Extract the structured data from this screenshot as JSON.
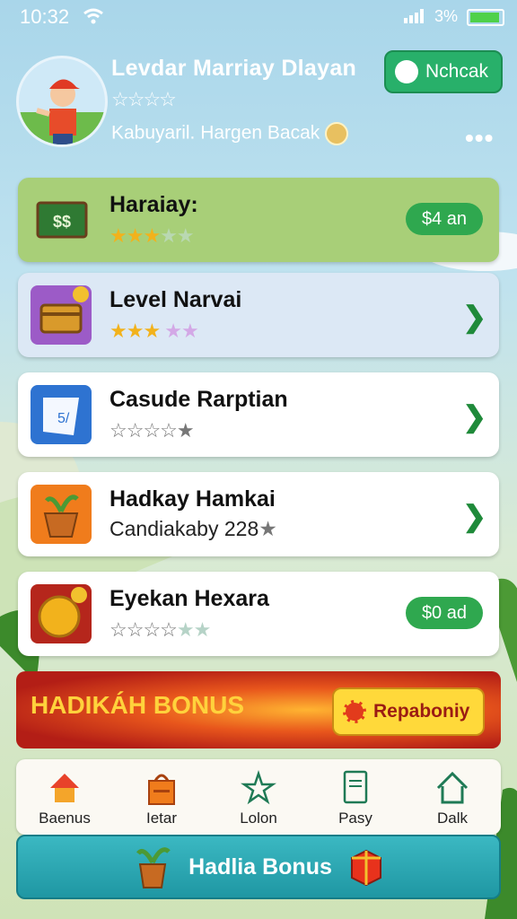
{
  "status_bar": {
    "time": "10:32",
    "battery": "3%"
  },
  "profile": {
    "name": "Levdar Marriay Dlayan",
    "stars": "☆☆☆☆",
    "subtitle": "Kabuyaril. Hargen Bacak",
    "check_button": "Nchcak"
  },
  "cards": [
    {
      "title": "Haraiay:",
      "rating": 3,
      "max": 5,
      "action": "$4 an",
      "icon": "cash-icon"
    },
    {
      "title": "Level Narvai",
      "rating": 3,
      "max": 5,
      "icon": "treasure-chest-icon"
    },
    {
      "title": "Casude Rarptian",
      "rating": 0,
      "max": 5,
      "icon": "flag-icon"
    },
    {
      "title": "Hadkay Hamkai",
      "subtitle": "Candiakaby 228",
      "icon": "plant-pot-icon"
    },
    {
      "title": "Eyekan Hexara",
      "rating": 0,
      "max": 5,
      "action": "$0 ad",
      "icon": "gold-coin-icon"
    }
  ],
  "bonus_banner": {
    "title": "HADIKÁH BONUS",
    "button": "Repaboniy"
  },
  "tabs": [
    {
      "label": "Baenus",
      "icon": "home-icon"
    },
    {
      "label": "Ietar",
      "icon": "shop-bag-icon"
    },
    {
      "label": "Lolon",
      "icon": "star-icon"
    },
    {
      "label": "Pasy",
      "icon": "document-icon"
    },
    {
      "label": "Dalk",
      "icon": "house-outline-icon"
    }
  ],
  "bottom_button": {
    "label": "Hadlia Bonus"
  },
  "colors": {
    "accent_green": "#2fa84f",
    "chevron_green": "#1f8a3a",
    "banner_red": "#b31e16",
    "teal": "#1f97a3"
  }
}
